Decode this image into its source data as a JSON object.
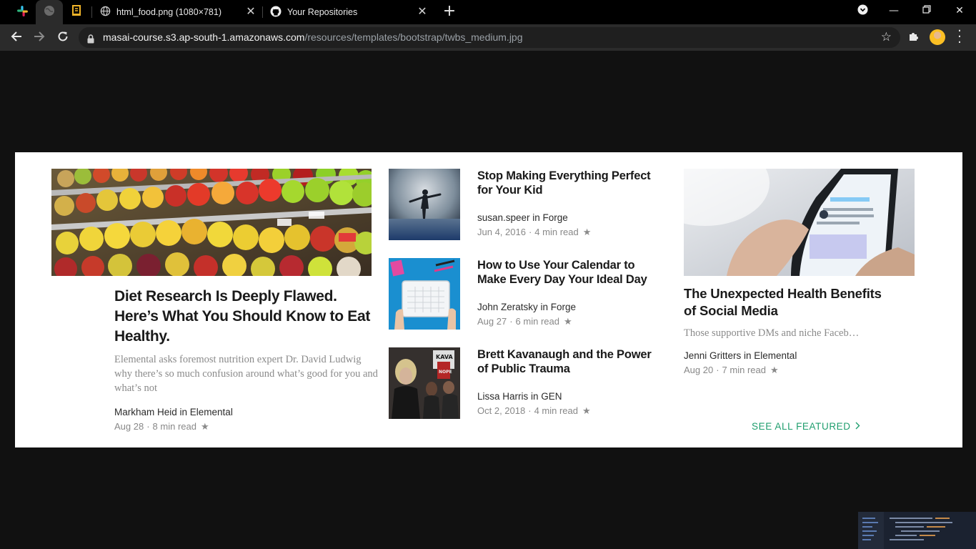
{
  "browser": {
    "tabs": [
      {
        "title": "html_food.png (1080×781)"
      },
      {
        "title": "Your Repositories"
      }
    ],
    "address": {
      "host": "masai-course.s3.ap-south-1.amazonaws.com",
      "path": "/resources/templates/bootstrap/twbs_medium.jpg"
    }
  },
  "featured": {
    "hero": {
      "title": "Diet Research Is Deeply Flawed. Here’s What You Should Know to Eat Healthy.",
      "subtitle": "Elemental asks foremost nutrition expert Dr. David Ludwig why there’s so much confusion around what’s good for you and what’s not",
      "author": "Markham Heid in Elemental",
      "date": "Aug 28",
      "read_time": "8 min read"
    },
    "middle": [
      {
        "title": "Stop Making Everything Perfect for Your Kid",
        "author": "susan.speer in Forge",
        "date": "Jun 4, 2016",
        "read_time": "4 min read"
      },
      {
        "title": "How to Use Your Calendar to Make Every Day Your Ideal Day",
        "author": "John Zeratsky in Forge",
        "date": "Aug 27",
        "read_time": "6 min read"
      },
      {
        "title": "Brett Kavanaugh and the Power of Public Trauma",
        "author": "Lissa Harris in GEN",
        "date": "Oct 2, 2018",
        "read_time": "4 min read"
      }
    ],
    "right": {
      "title": "The Unexpected Health Benefits of Social Media",
      "subtitle": "Those supportive DMs and niche Faceb…",
      "author": "Jenni Gritters in Elemental",
      "date": "Aug 20",
      "read_time": "7 min read"
    },
    "see_all": "SEE ALL FEATURED",
    "kava_sign": "KAVA",
    "nope_sign": "NOPE"
  },
  "colors": {
    "accent_green": "#1f9e6e",
    "page_background": "#111111"
  }
}
